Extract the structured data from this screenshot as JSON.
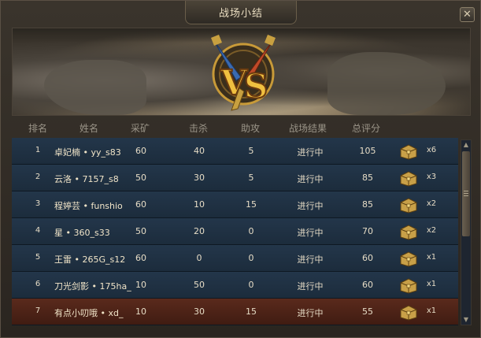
{
  "window": {
    "title": "战场小结",
    "close_label": "✕"
  },
  "columns": [
    "排名",
    "姓名",
    "采矿",
    "击杀",
    "助攻",
    "战场结果",
    "总评分"
  ],
  "rows": [
    {
      "rank": "1",
      "name": "卓妃楠 • yy_s83",
      "mine": "60",
      "kill": "40",
      "assist": "5",
      "result": "进行中",
      "score": "105",
      "count": "x6"
    },
    {
      "rank": "2",
      "name": "云洛 • 7157_s8",
      "mine": "50",
      "kill": "30",
      "assist": "5",
      "result": "进行中",
      "score": "85",
      "count": "x3"
    },
    {
      "rank": "3",
      "name": "程婷芸 • funshio",
      "mine": "60",
      "kill": "10",
      "assist": "15",
      "result": "进行中",
      "score": "85",
      "count": "x2"
    },
    {
      "rank": "4",
      "name": "星 • 360_s33",
      "mine": "50",
      "kill": "20",
      "assist": "0",
      "result": "进行中",
      "score": "70",
      "count": "x2"
    },
    {
      "rank": "5",
      "name": "王雷 • 265G_s12",
      "mine": "60",
      "kill": "0",
      "assist": "0",
      "result": "进行中",
      "score": "60",
      "count": "x1"
    },
    {
      "rank": "6",
      "name": "刀光剑影 • 175ha_",
      "mine": "10",
      "kill": "50",
      "assist": "0",
      "result": "进行中",
      "score": "60",
      "count": "x1"
    },
    {
      "rank": "7",
      "name": "有点小叨哦 • xd_",
      "mine": "10",
      "kill": "30",
      "assist": "15",
      "result": "进行中",
      "score": "55",
      "count": "x1"
    }
  ],
  "highlight_row": 7,
  "colors": {
    "accent_gold": "#e8b840",
    "row_blue": "#23364a",
    "row_highlight": "#5a2a1c"
  },
  "icons": {
    "close": "close-icon",
    "chest": "treasure-chest-icon",
    "emblem": "vs-emblem-icon"
  }
}
